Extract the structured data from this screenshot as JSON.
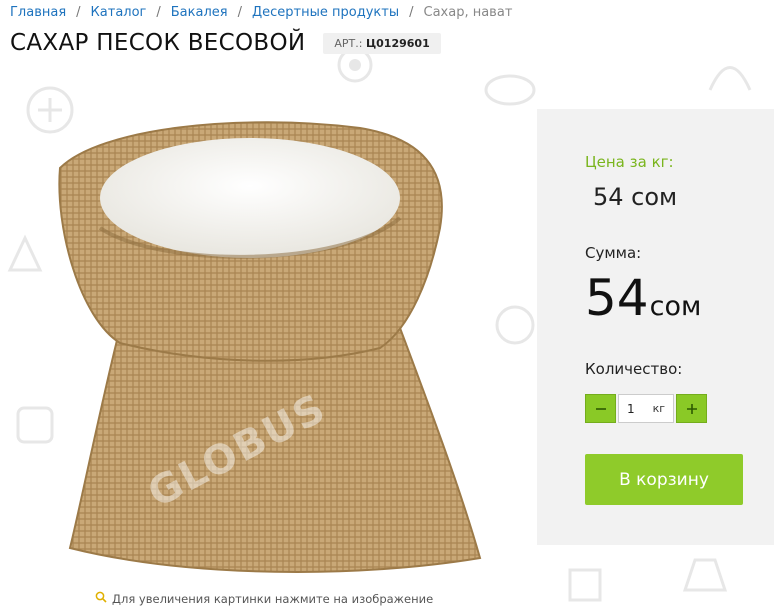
{
  "breadcrumb": {
    "items": [
      "Главная",
      "Каталог",
      "Бакалея",
      "Десертные продукты"
    ],
    "current": "Сахар, нават",
    "separator": "/"
  },
  "product": {
    "title": "САХАР ПЕСОК ВЕСОВОЙ",
    "art_label": "АРТ.:",
    "art_code": "Ц0129601",
    "image_watermark": "GLOBUS",
    "zoom_hint": "Для увеличения картинки нажмите на изображение"
  },
  "buy_panel": {
    "price_label": "Цена за кг:",
    "price_value": "54 сом",
    "sum_label": "Сумма:",
    "sum_number": "54",
    "sum_currency": "сом",
    "qty_label": "Количество:",
    "qty_value": "1",
    "qty_unit": "кг",
    "cart_label": "В корзину"
  },
  "colors": {
    "accent_green": "#8fcb2a",
    "link_blue": "#1e73be",
    "panel_bg": "#f2f2f2"
  },
  "icons": [
    "minus-icon",
    "plus-icon",
    "search-icon"
  ]
}
